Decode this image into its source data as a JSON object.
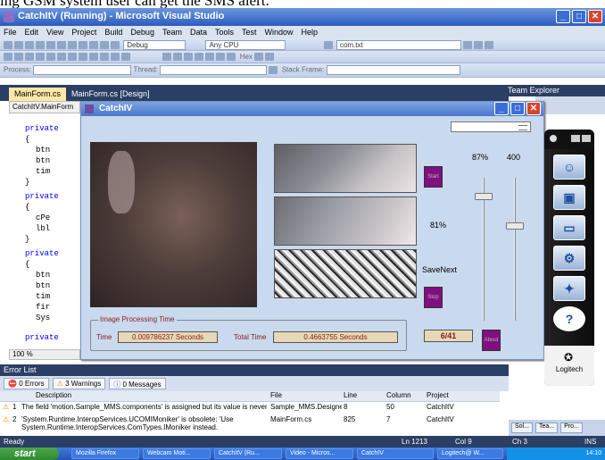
{
  "caption": "ing GSM system user can get the SMS alert.",
  "vs": {
    "title": "CatchItV (Running) - Microsoft Visual Studio",
    "menu": [
      "File",
      "Edit",
      "View",
      "Project",
      "Build",
      "Debug",
      "Team",
      "Data",
      "Tools",
      "Test",
      "Window",
      "Help"
    ],
    "toolbar1": {
      "config": "Debug",
      "platform": "Any CPU",
      "file": "com.txt"
    },
    "toolbar2": {
      "hex": "Hex"
    },
    "toolbar3": {
      "process": "Process:",
      "thread": "Thread:",
      "stack": "Stack Frame:"
    },
    "tabs": [
      "MainForm.cs",
      "MainForm.cs [Design]"
    ],
    "nav": "CatchItV.MainForm",
    "code": [
      "private",
      "{",
      "btn",
      "btn",
      "tim",
      "}",
      "private",
      "{",
      "cPe",
      "lbl",
      "}",
      "private",
      "{",
      "btn",
      "btn",
      "tim",
      "fir",
      "Sys",
      "private"
    ],
    "team_explorer": "Team Explorer",
    "zoom": "100 %"
  },
  "app": {
    "title": "CatchIV",
    "percent_top": "87%",
    "value_top": "400",
    "percent_mid": "81%",
    "save_next": "SaveNext",
    "start_btn": "Start",
    "stop_btn": "Stop",
    "about_btn": "About",
    "group_title": "Image Processing Time",
    "time_label": "Time",
    "time_value": "0.009786237 Seconds",
    "total_label": "Total Time",
    "total_value": "0.4663755 Seconds",
    "counter": "6/41"
  },
  "logitech": {
    "brand": "Logitech",
    "icons": [
      "person-icon",
      "picture-icon",
      "monitor-icon",
      "gears-icon",
      "sparkle-icon",
      "help-icon"
    ]
  },
  "errors": {
    "title": "Error List",
    "tabs": [
      "0 Errors",
      "3 Warnings",
      "0 Messages"
    ],
    "headers": [
      "Description",
      "File",
      "Line",
      "Column",
      "Project"
    ],
    "rows": [
      {
        "n": "1",
        "desc": "The field 'motion.Sample_MMS.components' is assigned but its value is never used",
        "file": "Sample_MMS.Designer.c",
        "line": "8",
        "col": "50",
        "proj": "CatchItV"
      },
      {
        "n": "2",
        "desc": "'System.Runtime.InteropServices.UCOMIMoniker' is obsolete: 'Use System.Runtime.InteropServices.ComTypes.IMoniker instead.",
        "file": "MainForm.cs",
        "line": "825",
        "col": "7",
        "proj": "CatchItV"
      }
    ]
  },
  "status": {
    "ready": "Ready",
    "ln": "Ln 1213",
    "col": "Col 9",
    "ch": "Ch 3",
    "ins": "INS"
  },
  "right_tabs": [
    "Sol...",
    "Tea...",
    "Pro..."
  ],
  "taskbar": {
    "start": "start",
    "tasks": [
      "Mozilla Firefox",
      "Webcam Moti...",
      "CatchItV (Ru...",
      "Video - Micros...",
      "CatchIV",
      "Logitech@ W..."
    ],
    "time": "14:10"
  }
}
